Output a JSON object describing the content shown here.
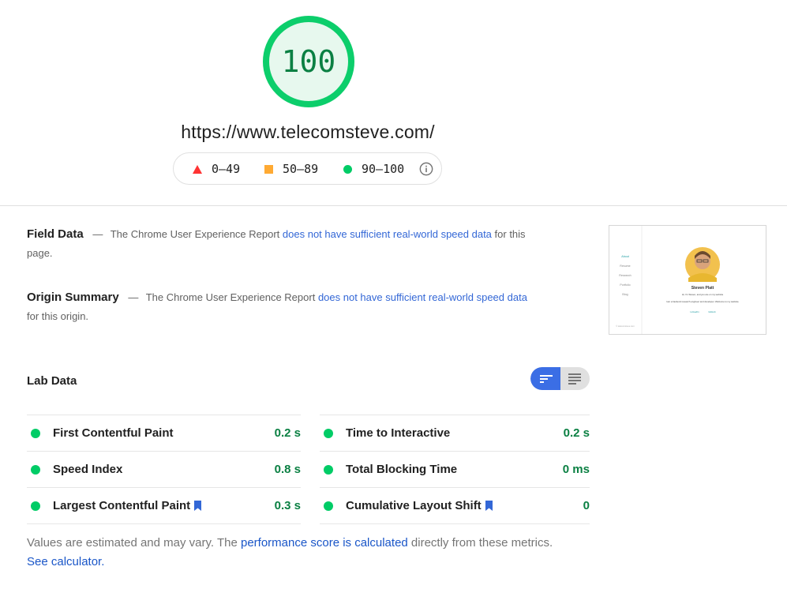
{
  "gauge": {
    "score": "100",
    "percent": 100,
    "color": "#0cce6b"
  },
  "url": "https://www.telecomsteve.com/",
  "legend": {
    "fail": "0–49",
    "average": "50–89",
    "pass": "90–100",
    "colors": {
      "fail": "#ff3333",
      "average": "#ffaa33",
      "pass": "#00cc66"
    }
  },
  "field_data": {
    "title": "Field Data",
    "dash": "—",
    "text": "The Chrome User Experience Report",
    "link": "does not have sufficient real-world speed data",
    "tail": "for this page."
  },
  "origin_summary": {
    "title": "Origin Summary",
    "dash": "—",
    "text": "The Chrome User Experience Report",
    "link": "does not have sufficient real-world speed data",
    "tail": "for this origin."
  },
  "thumbnail": {
    "nav": [
      "About",
      "Resume",
      "Research",
      "Portfolio",
      "Blog"
    ],
    "name": "Steven Platt",
    "line1": "Hi, I'm Steven, and you are on my website",
    "line2": "I am a backend research engineer and developer. Welcome to my website.",
    "links": [
      "LinkedIn",
      "GitHub"
    ],
    "footer": "© telecomsteve.com"
  },
  "lab_data": {
    "title": "Lab Data",
    "left_metrics": [
      {
        "label": "First Contentful Paint",
        "value": "0.2 s",
        "bookmark": false
      },
      {
        "label": "Speed Index",
        "value": "0.8 s",
        "bookmark": false
      },
      {
        "label": "Largest Contentful Paint",
        "value": "0.3 s",
        "bookmark": true
      }
    ],
    "right_metrics": [
      {
        "label": "Time to Interactive",
        "value": "0.2 s",
        "bookmark": false
      },
      {
        "label": "Total Blocking Time",
        "value": "0 ms",
        "bookmark": false
      },
      {
        "label": "Cumulative Layout Shift",
        "value": "0",
        "bookmark": true
      }
    ]
  },
  "footer": {
    "text1": "Values are estimated and may vary. The",
    "link1": "performance score is calculated",
    "text2": "directly from these metrics.",
    "link2": "See calculator."
  },
  "icons": {
    "info": "info-icon",
    "bookmark": "bookmark-icon",
    "view_bars": "bar-view-icon",
    "view_list": "list-view-icon"
  }
}
